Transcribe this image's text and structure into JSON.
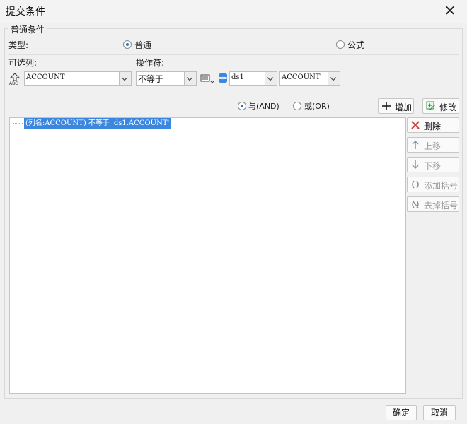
{
  "window": {
    "title": "提交条件"
  },
  "group_title": "普通条件",
  "type_row": {
    "label": "类型:",
    "options": [
      {
        "label": "普通",
        "selected": true
      },
      {
        "label": "公式",
        "selected": false
      }
    ]
  },
  "columns_label": "可选列:",
  "operator_label": "操作符:",
  "column_select": {
    "value": "ACCOUNT"
  },
  "operator_select": {
    "value": "不等于"
  },
  "ds_select": {
    "value": "ds1"
  },
  "field_select": {
    "value": "ACCOUNT"
  },
  "logic": {
    "and_label": "与(AND)",
    "or_label": "或(OR)",
    "selected": "and"
  },
  "actions": {
    "add": "增加",
    "modify": "修改",
    "delete": "删除",
    "move_up": "上移",
    "move_down": "下移",
    "add_bracket": "添加括号",
    "remove_bracket": "去掉括号"
  },
  "conditions": [
    "(列名:ACCOUNT) 不等于 'ds1.ACCOUNT'"
  ],
  "footer": {
    "ok": "确定",
    "cancel": "取消"
  },
  "colors": {
    "accent": "#3b87e0",
    "delete_red": "#d83b3b",
    "add_green": "#2e9b3e"
  }
}
